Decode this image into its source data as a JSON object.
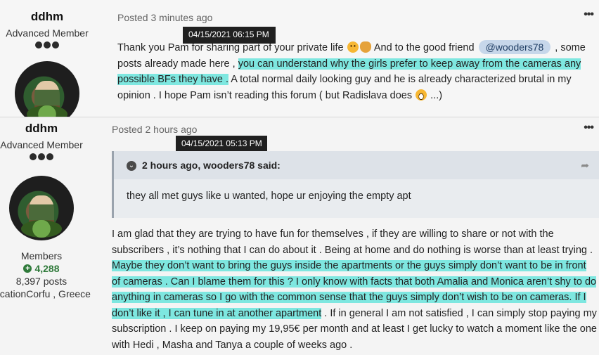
{
  "posts": [
    {
      "author": {
        "name": "ddhm",
        "rank": "Advanced Member",
        "rank_pips": 3
      },
      "meta": {
        "prefix": "Posted",
        "when": "3 minutes ago",
        "tooltip": "04/15/2021 06:15  PM"
      },
      "more_label": "•••",
      "body": {
        "t1": "Thank you Pam for sharing part of your private life ",
        "t2": " And to the good friend ",
        "mention": "@wooders78",
        "t3": " , some posts already made here , ",
        "hl1": "you can understand why the girls prefer to keep away from the cameras any possible BFs they have .",
        "t4": " A total normal daily looking guy and he is already characterized brutal in my opinion . I hope Pam isn’t reading this forum ( but Radislava does ",
        "t5": " ...)"
      }
    },
    {
      "author": {
        "name": "ddhm",
        "rank": "Advanced Member",
        "rank_pips": 3,
        "group": "Members",
        "reputation": "4,288",
        "posts": "8,397 posts",
        "location": "ocationCorfu , Greece"
      },
      "meta": {
        "prefix": "Posted",
        "when": "2 hours ago",
        "tooltip": "04/15/2021 05:13  PM"
      },
      "more_label": "•••",
      "quote": {
        "by": "2 hours ago, wooders78 said:",
        "text": "they all met guys like u wanted, hope ur enjoying the empty apt"
      },
      "body": {
        "t1": "I am glad that they are trying to have fun for themselves , if they are willing to share or not  with  the subscribers , it’s nothing that I can do about it . Being at home and do nothing is worse than at least trying . ",
        "hl1": "Maybe they don’t want to bring the guys inside the apartments or the guys simply don’t  want to be in front of cameras . Can I blame them for this ? I only know with facts that both Amalia and Monica aren’t shy to do anything in cameras so I go with the common sense that the guys simply don’t wish to be on cameras. If I don’t like it , I can tune in at another apartment",
        "t2": " . If in general I am not satisfied , I can simply stop paying my subscription . I keep on paying my 19,95€ per month and at least I get lucky to watch a moment like the one with Hedi , Masha and Tanya a couple of weeks ago ."
      }
    }
  ],
  "icons": {
    "emoji_1": "smiling-face-icon",
    "emoji_2": "clapping-hands-icon",
    "emoji_3": "grinning-face-icon",
    "reputation": "plus-circle-icon",
    "quote_toggle": "chevron-down-icon",
    "quote_share": "share-arrow-icon"
  },
  "colors": {
    "highlight": "#7ee7e0",
    "mention_bg": "#c7d7ea",
    "reputation": "#2f7a3a",
    "tooltip_bg": "#202020"
  }
}
